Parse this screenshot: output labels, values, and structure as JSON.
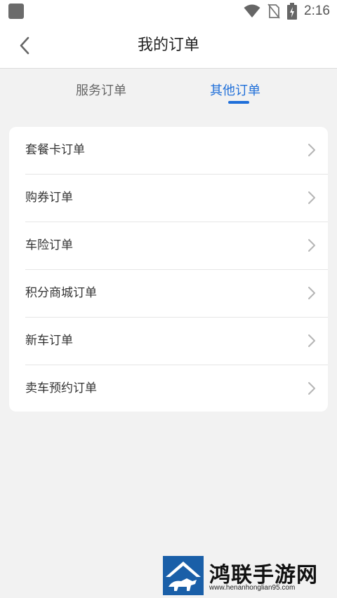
{
  "status_bar": {
    "time": "2:16",
    "icons": [
      "app-icon",
      "wifi-icon",
      "no-sim-icon",
      "battery-charging-icon"
    ]
  },
  "header": {
    "title": "我的订单",
    "back_icon": "chevron-left-icon"
  },
  "tabs": [
    {
      "label": "服务订单",
      "active": false
    },
    {
      "label": "其他订单",
      "active": true
    }
  ],
  "orders": [
    {
      "label": "套餐卡订单"
    },
    {
      "label": "购券订单"
    },
    {
      "label": "车险订单"
    },
    {
      "label": "积分商城订单"
    },
    {
      "label": "新车订单"
    },
    {
      "label": "卖车预约订单"
    }
  ],
  "colors": {
    "accent": "#1f6fd9",
    "background": "#f2f2f2",
    "card": "#ffffff"
  },
  "watermark": {
    "name": "鸿联手游网",
    "url": "www.henanhonglian95.com"
  }
}
